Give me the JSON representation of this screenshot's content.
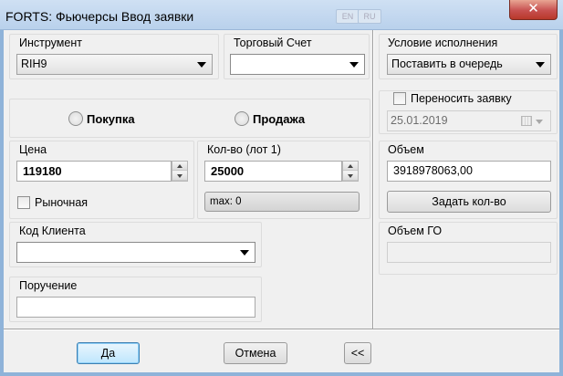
{
  "window": {
    "title": "FORTS: Фьючерсы Ввод заявки",
    "close_label": "✕",
    "ghost_buttons": [
      "EN",
      "RU"
    ]
  },
  "instrument": {
    "label": "Инструмент",
    "value": "RIH9"
  },
  "account": {
    "label": "Торговый Счет",
    "value": ""
  },
  "condition": {
    "label": "Условие исполнения",
    "value": "Поставить в очередь"
  },
  "side": {
    "buy_label": "Покупка",
    "sell_label": "Продажа"
  },
  "transfer": {
    "label": "Переносить заявку",
    "date": "25.01.2019"
  },
  "price": {
    "label": "Цена",
    "value": "119180",
    "market_label": "Рыночная"
  },
  "quantity": {
    "label": "Кол-во (лот 1)",
    "value": "25000",
    "max_label": "max: 0"
  },
  "volume": {
    "label": "Объем",
    "value": "3918978063,00",
    "set_qty_button": "Задать кол-во"
  },
  "client_code": {
    "label": "Код Клиента",
    "value": ""
  },
  "margin": {
    "label": "Объем ГО",
    "value": ""
  },
  "instruction": {
    "label": "Поручение",
    "value": ""
  },
  "buttons": {
    "ok": "Да",
    "cancel": "Отмена",
    "collapse": "<<"
  }
}
